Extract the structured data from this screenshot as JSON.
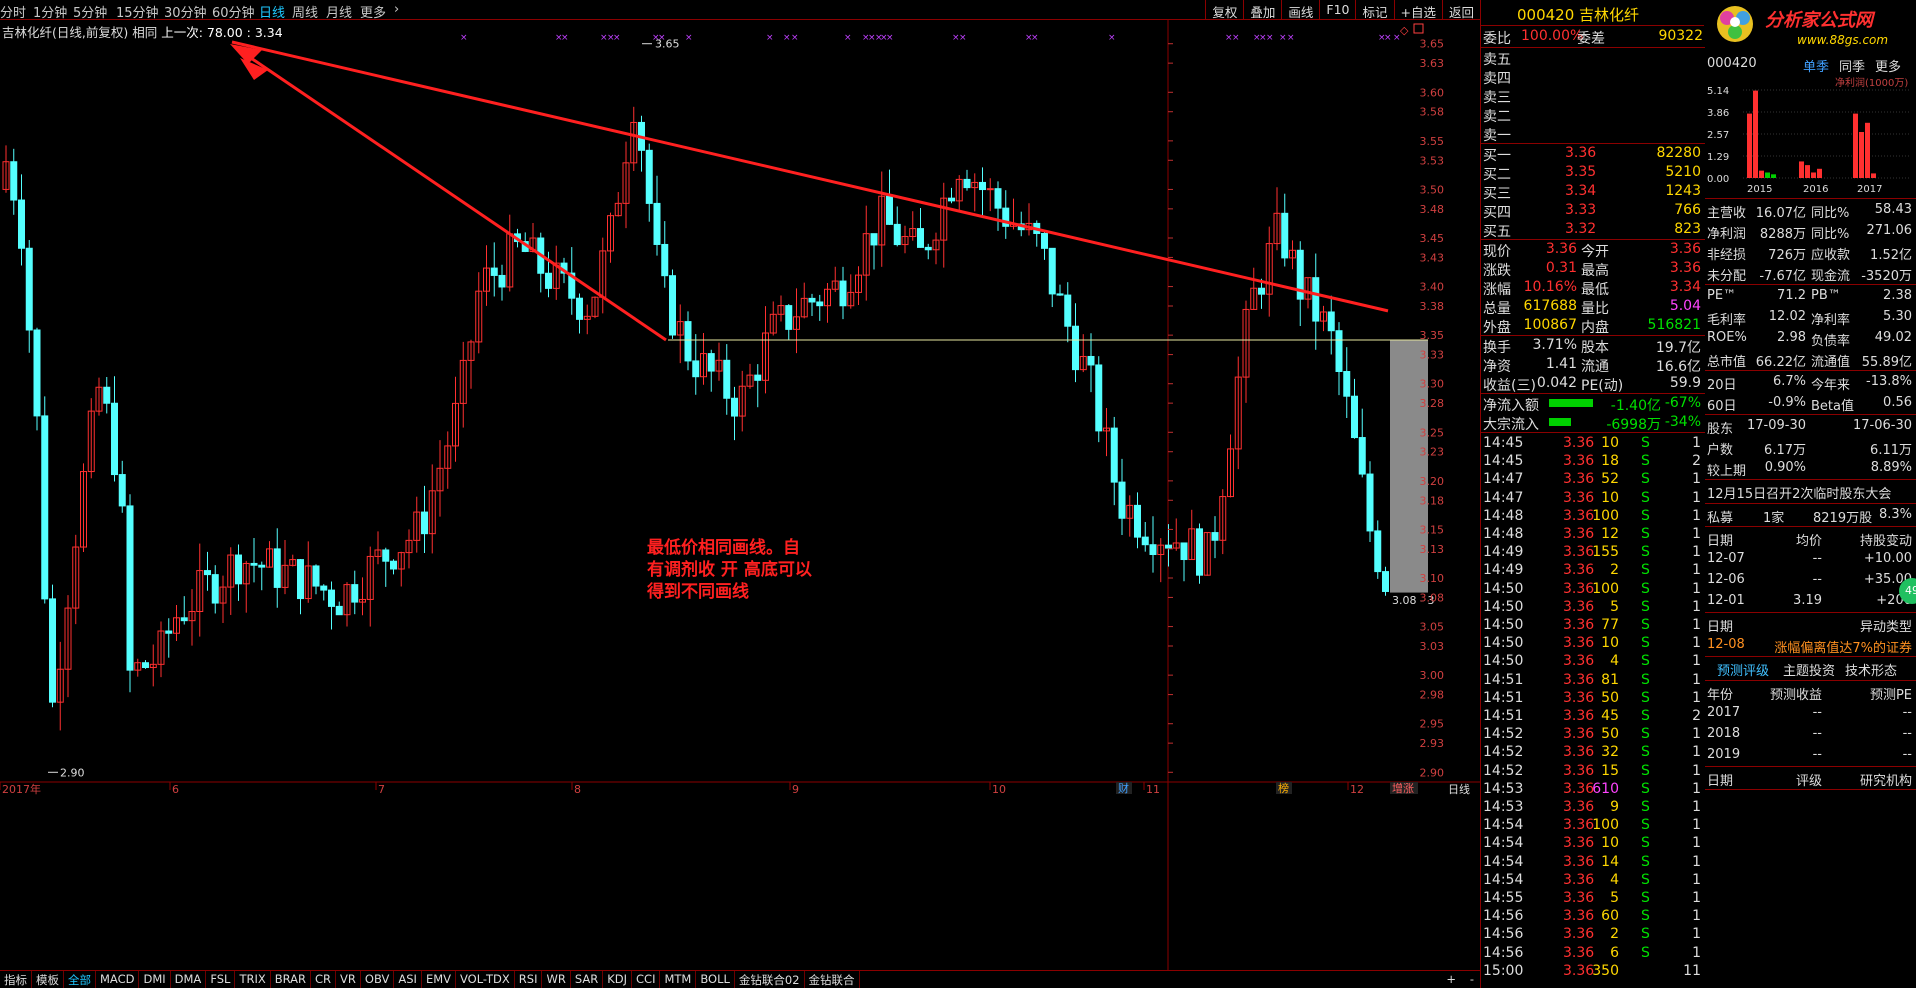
{
  "periods": [
    "分时",
    "1分钟",
    "5分钟",
    "15分钟",
    "30分钟",
    "60分钟",
    "日线",
    "周线",
    "月线",
    "更多"
  ],
  "active_period": "日线",
  "toolbar": [
    "复权",
    "叠加",
    "画线",
    "F10",
    "标记",
    "+自选",
    "返回"
  ],
  "chart": {
    "title": "吉林化纤(日线,前复权) 相同",
    "last_label": "上一次: 78.00 : 3.34",
    "y_ticks": [
      "3.65",
      "3.63",
      "3.60",
      "3.58",
      "3.55",
      "3.53",
      "3.50",
      "3.48",
      "3.45",
      "3.43",
      "3.40",
      "3.38",
      "3.35",
      "3.33",
      "3.30",
      "3.28",
      "3.25",
      "3.23",
      "3.20",
      "3.18",
      "3.15",
      "3.13",
      "3.10",
      "3.08",
      "3.05",
      "3.03",
      "3.00",
      "2.98",
      "2.95",
      "2.93",
      "2.90"
    ],
    "month_labels": [
      "2017年",
      "6",
      "7",
      "8",
      "9",
      "10",
      "11",
      "12"
    ],
    "high_label": "3.65",
    "low_label": "2.90",
    "cursor_label": "3.08 - 3",
    "corner_label": "日线",
    "badges": [
      "财",
      "榜",
      "增涨"
    ],
    "annotation": [
      "最低价相同画线。自",
      "有调剂收 开 高底可以",
      "得到不同画线"
    ],
    "colors": {
      "up": "#ff3030",
      "down": "#54ffff",
      "trend": "#ff2020",
      "flat": "#e8e8a0"
    }
  },
  "chart_data": {
    "type": "candlestick",
    "ylim": [
      2.89,
      3.66
    ],
    "y_step": 0.025,
    "annotations": [
      "3.65",
      "2.90"
    ]
  },
  "bottom_tabs": [
    "指标",
    "模板",
    "全部",
    "MACD",
    "DMI",
    "DMA",
    "FSL",
    "TRIX",
    "BRAR",
    "CR",
    "VR",
    "OBV",
    "ASI",
    "EMV",
    "VOL-TDX",
    "RSI",
    "WR",
    "SAR",
    "KDJ",
    "CCI",
    "MTM",
    "BOLL",
    "金钻联合02",
    "金钻联合"
  ],
  "bottom_active": "全部",
  "quote": {
    "code": "000420",
    "name": "吉林化纤",
    "wei_bi_label": "委比",
    "wei_bi": "100.00%",
    "wei_cha_label": "委差",
    "wei_cha": "90322",
    "sell": [
      "卖五",
      "卖四",
      "卖三",
      "卖二",
      "卖一"
    ],
    "buy": [
      {
        "label": "买一",
        "price": "3.36",
        "vol": "82280"
      },
      {
        "label": "买二",
        "price": "3.35",
        "vol": "5210"
      },
      {
        "label": "买三",
        "price": "3.34",
        "vol": "1243"
      },
      {
        "label": "买四",
        "price": "3.33",
        "vol": "766"
      },
      {
        "label": "买五",
        "price": "3.32",
        "vol": "823"
      }
    ],
    "stats": [
      {
        "l1": "现价",
        "v1": "3.36",
        "l2": "今开",
        "v2": "3.36"
      },
      {
        "l1": "涨跌",
        "v1": "0.31",
        "l2": "最高",
        "v2": "3.36"
      },
      {
        "l1": "涨幅",
        "v1": "10.16%",
        "l2": "最低",
        "v2": "3.34"
      },
      {
        "l1": "总量",
        "v1": "617688",
        "l2": "量比",
        "v2": "5.04"
      },
      {
        "l1": "外盘",
        "v1": "100867",
        "l2": "内盘",
        "v2": "516821"
      }
    ],
    "stats2": [
      {
        "l1": "换手",
        "v1": "3.71%",
        "l2": "股本",
        "v2": "19.7亿"
      },
      {
        "l1": "净资",
        "v1": "1.41",
        "l2": "流通",
        "v2": "16.6亿"
      },
      {
        "l1": "收益(三)",
        "v1": "0.042",
        "l2": "PE(动)",
        "v2": "59.9"
      }
    ],
    "flow": [
      {
        "label": "净流入额",
        "value": "-1.40亿",
        "pct": "-67%"
      },
      {
        "label": "大宗流入",
        "value": "-6998万",
        "pct": "-34%"
      }
    ],
    "ticks": [
      [
        "14:45",
        "3.36",
        "10",
        "S",
        "1"
      ],
      [
        "14:45",
        "3.36",
        "18",
        "S",
        "2"
      ],
      [
        "14:47",
        "3.36",
        "52",
        "S",
        "1"
      ],
      [
        "14:47",
        "3.36",
        "10",
        "S",
        "1"
      ],
      [
        "14:48",
        "3.36",
        "100",
        "S",
        "1"
      ],
      [
        "14:48",
        "3.36",
        "12",
        "S",
        "1"
      ],
      [
        "14:49",
        "3.36",
        "155",
        "S",
        "1"
      ],
      [
        "14:49",
        "3.36",
        "2",
        "S",
        "1"
      ],
      [
        "14:50",
        "3.36",
        "100",
        "S",
        "1"
      ],
      [
        "14:50",
        "3.36",
        "5",
        "S",
        "1"
      ],
      [
        "14:50",
        "3.36",
        "77",
        "S",
        "1"
      ],
      [
        "14:50",
        "3.36",
        "10",
        "S",
        "1"
      ],
      [
        "14:50",
        "3.36",
        "4",
        "S",
        "1"
      ],
      [
        "14:51",
        "3.36",
        "81",
        "S",
        "1"
      ],
      [
        "14:51",
        "3.36",
        "50",
        "S",
        "1"
      ],
      [
        "14:51",
        "3.36",
        "45",
        "S",
        "2"
      ],
      [
        "14:52",
        "3.36",
        "50",
        "S",
        "1"
      ],
      [
        "14:52",
        "3.36",
        "32",
        "S",
        "1"
      ],
      [
        "14:52",
        "3.36",
        "15",
        "S",
        "1"
      ],
      [
        "14:53",
        "3.36",
        "610",
        "S",
        "1"
      ],
      [
        "14:53",
        "3.36",
        "9",
        "S",
        "1"
      ],
      [
        "14:54",
        "3.36",
        "100",
        "S",
        "1"
      ],
      [
        "14:54",
        "3.36",
        "10",
        "S",
        "1"
      ],
      [
        "14:54",
        "3.36",
        "14",
        "S",
        "1"
      ],
      [
        "14:54",
        "3.36",
        "4",
        "S",
        "1"
      ],
      [
        "14:55",
        "3.36",
        "5",
        "S",
        "1"
      ],
      [
        "14:56",
        "3.36",
        "60",
        "S",
        "1"
      ],
      [
        "14:56",
        "3.36",
        "2",
        "S",
        "1"
      ],
      [
        "14:56",
        "3.36",
        "6",
        "S",
        "1"
      ],
      [
        "15:00",
        "3.36",
        "350",
        "",
        "11"
      ]
    ]
  },
  "f10": {
    "logo": "分析家公式网",
    "logo_url": "www.88gs.com",
    "code": "000420",
    "tabs": [
      "单季",
      "同季",
      "更多"
    ],
    "chart_label": "净利润(1000万)",
    "y_vals": [
      "5.14",
      "3.86",
      "2.57",
      "1.29",
      "0.00"
    ],
    "years": [
      "2015",
      "2016",
      "2017"
    ],
    "fin": [
      {
        "l1": "主营收",
        "v1": "16.07亿",
        "l2": "同比%",
        "v2": "58.43"
      },
      {
        "l1": "净利润",
        "v1": "8288万",
        "l2": "同比%",
        "v2": "271.06"
      },
      {
        "l1": "非经损",
        "v1": "726万",
        "l2": "应收款",
        "v2": "1.52亿"
      },
      {
        "l1": "未分配",
        "v1": "-7.67亿",
        "l2": "现金流",
        "v2": "-3520万"
      }
    ],
    "val": [
      {
        "l1": "PE™",
        "v1": "71.2",
        "l2": "PB™",
        "v2": "2.38"
      },
      {
        "l1": "毛利率",
        "v1": "12.02",
        "l2": "净利率",
        "v2": "5.30"
      },
      {
        "l1": "ROE%",
        "v1": "2.98",
        "l2": "负债率",
        "v2": "49.02"
      },
      {
        "l1": "总市值",
        "v1": "66.22亿",
        "l2": "流通值",
        "v2": "55.89亿"
      }
    ],
    "perf": [
      {
        "l1": "20日",
        "v1": "6.7%",
        "l2": "今年来",
        "v2": "-13.8%"
      },
      {
        "l1": "60日",
        "v1": "-0.9%",
        "l2": "Beta值",
        "v2": "0.56"
      }
    ],
    "holders": [
      {
        "l1": "股东",
        "v1": "17-09-30",
        "v2": "17-06-30"
      },
      {
        "l1": "户数",
        "v1": "6.17万",
        "v2": "6.11万"
      },
      {
        "l1": "较上期",
        "v1": "0.90%",
        "v2": "8.89%"
      }
    ],
    "notice": "12月15日召开2次临时股东大会",
    "private": {
      "l1": "私募",
      "v1": "1家",
      "v2": "8219万股",
      "v3": "8.3%"
    },
    "chg_header": {
      "c1": "日期",
      "c2": "均价",
      "c3": "持股变动"
    },
    "chg": [
      {
        "c1": "12-07",
        "c2": "--",
        "c3": "+10.00"
      },
      {
        "c1": "12-06",
        "c2": "--",
        "c3": "+35.00"
      },
      {
        "c1": "12-01",
        "c2": "3.19",
        "c3": "+200"
      }
    ],
    "abn_header": {
      "c1": "日期",
      "c3": "异动类型"
    },
    "abn": {
      "c1": "12-08",
      "c3": "涨幅偏离值达7%的证券"
    },
    "fc_tabs": [
      "预测评级",
      "主题投资",
      "技术形态"
    ],
    "fc_header": {
      "c1": "年份",
      "c2": "预测收益",
      "c3": "预测PE"
    },
    "fc": [
      {
        "c1": "2017",
        "c2": "--",
        "c3": "--"
      },
      {
        "c1": "2018",
        "c2": "--",
        "c3": "--"
      },
      {
        "c1": "2019",
        "c2": "--",
        "c3": "--"
      }
    ],
    "rating_header": {
      "c1": "日期",
      "c2": "评级",
      "c3": "研究机构"
    },
    "badge": "49"
  }
}
